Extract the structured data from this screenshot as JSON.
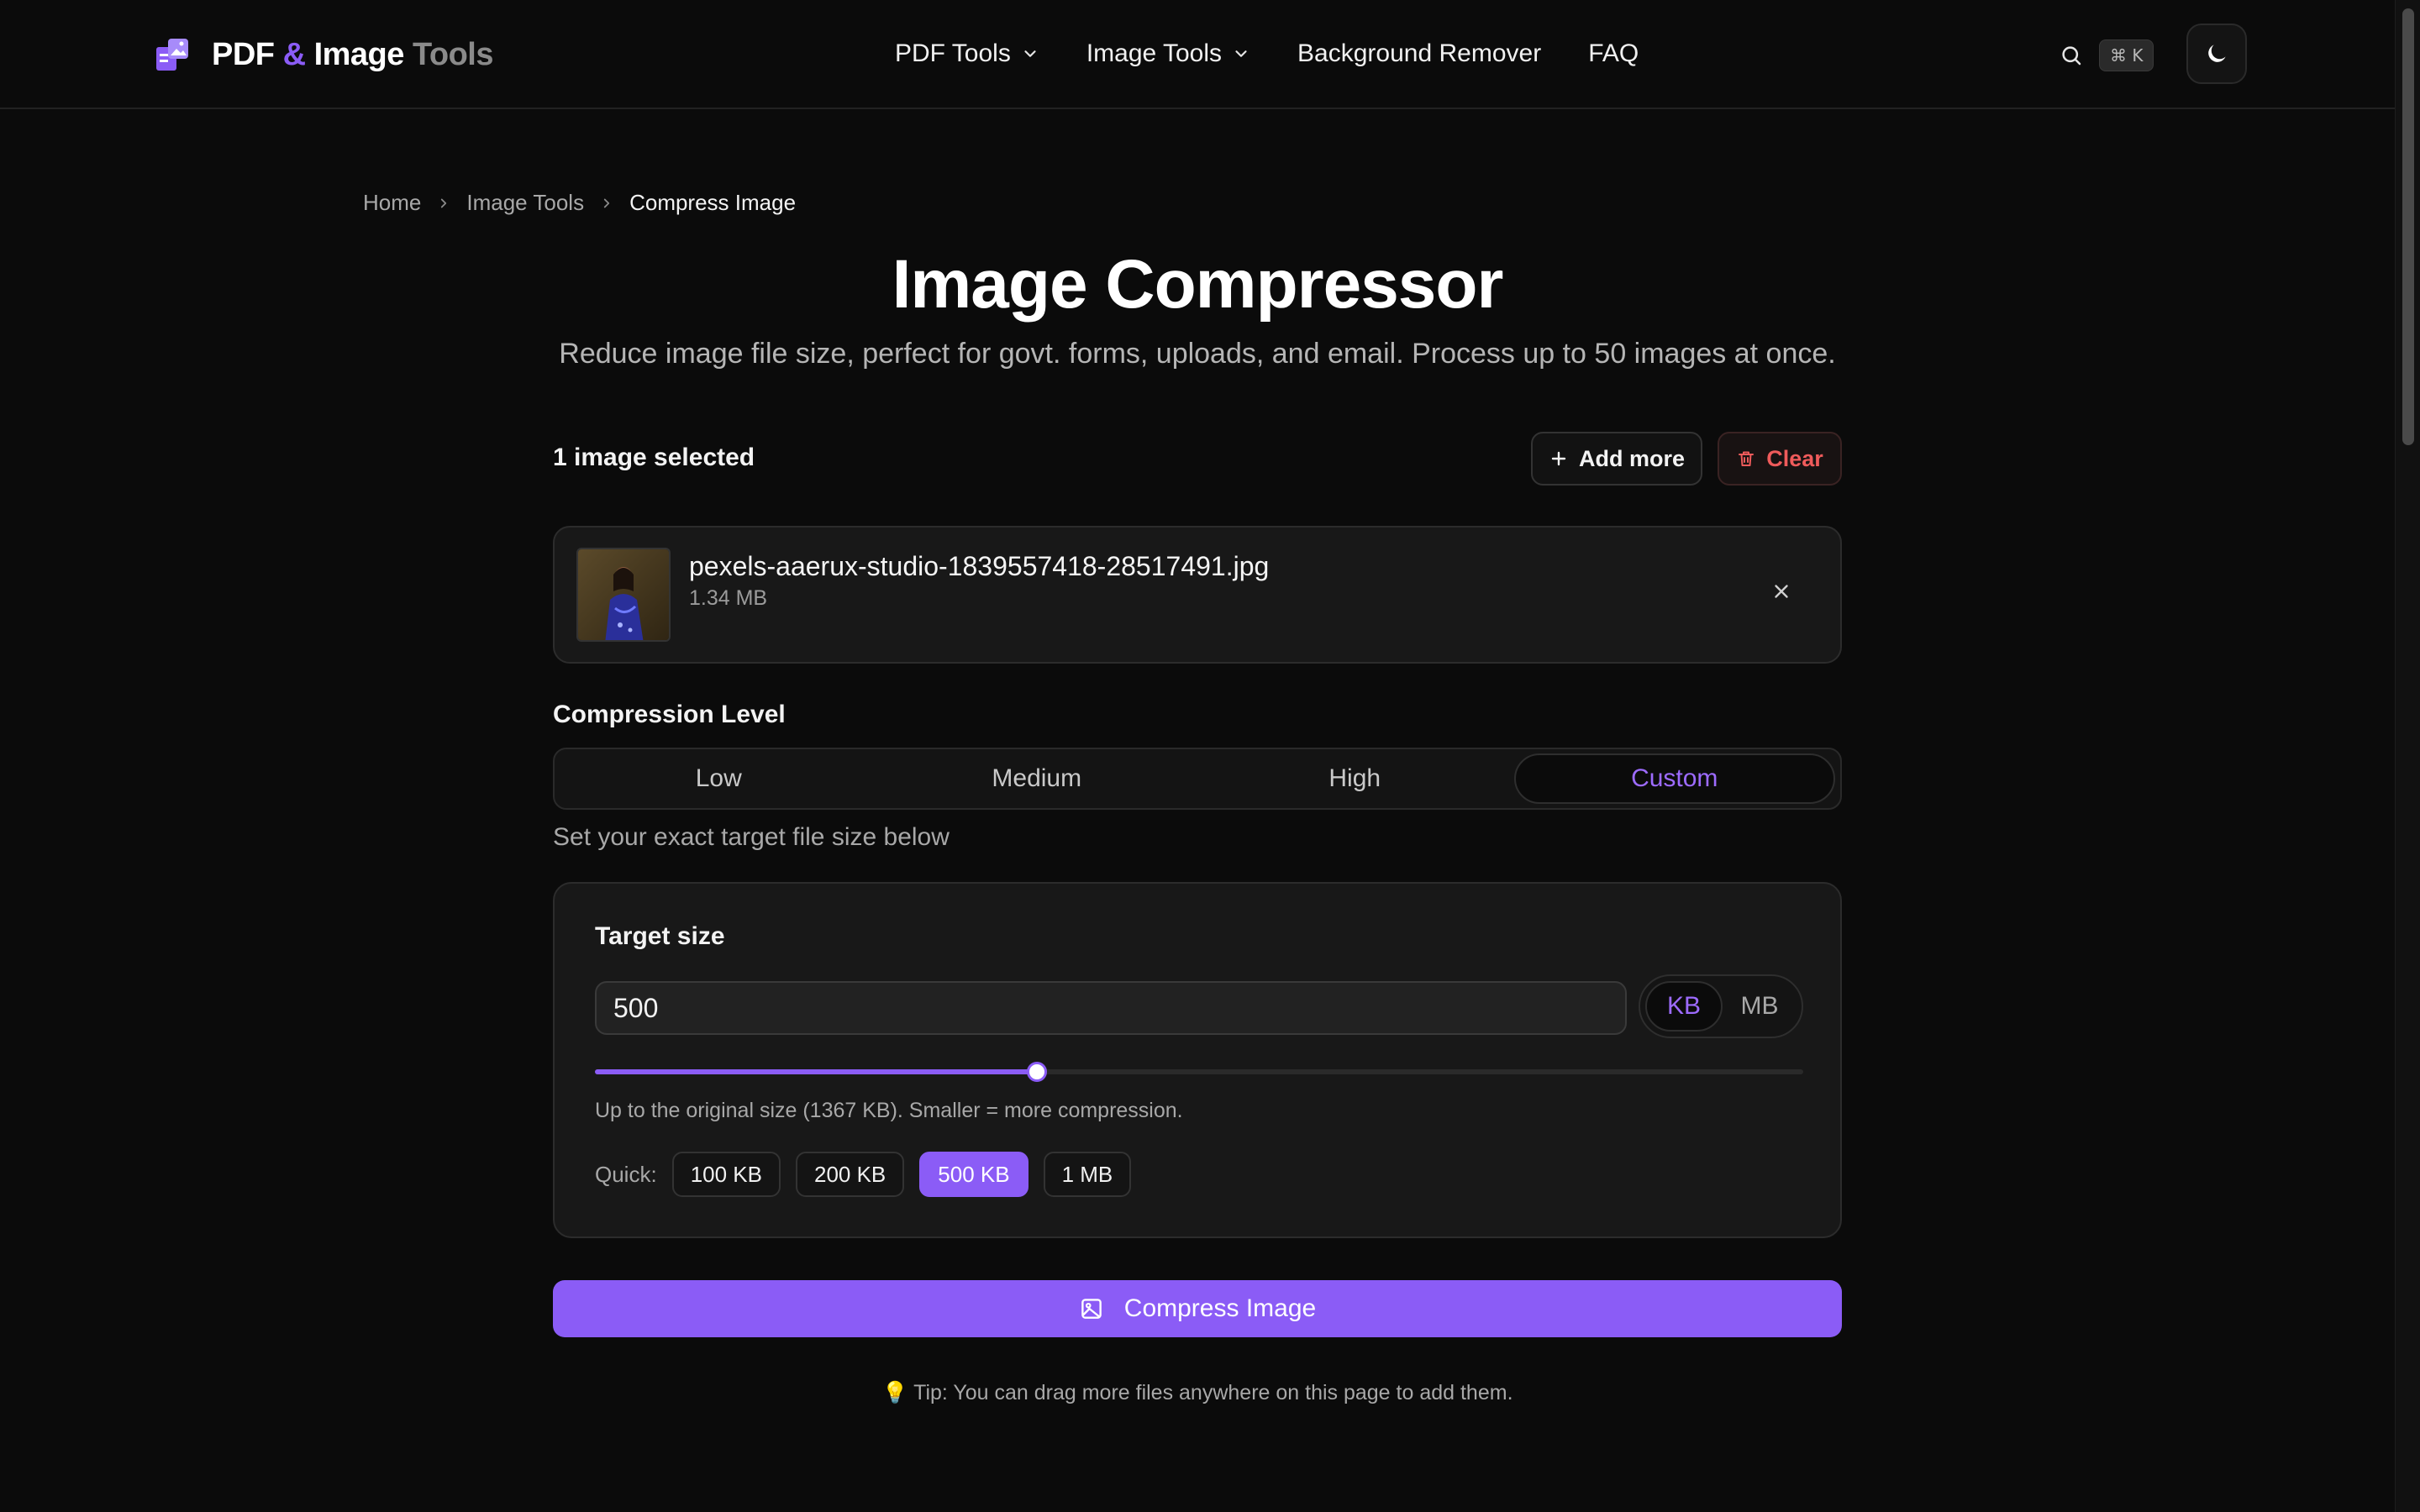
{
  "brand": {
    "part1": "PDF",
    "amp": "&",
    "part2": "Image",
    "part3": "Tools",
    "logo_icon": "pdf-image-logo"
  },
  "nav": {
    "pdf_tools": "PDF Tools",
    "image_tools": "Image Tools",
    "bg_remover": "Background Remover",
    "faq": "FAQ"
  },
  "search": {
    "shortcut": "⌘ K"
  },
  "breadcrumb": {
    "home": "Home",
    "section": "Image Tools",
    "current": "Compress Image"
  },
  "hero": {
    "title": "Image Compressor",
    "subtitle": "Reduce image file size, perfect for govt. forms, uploads, and email. Process up to 50 images at once."
  },
  "selection": {
    "count_label": "1 image selected",
    "add_more": "Add more",
    "clear": "Clear"
  },
  "file": {
    "name": "pexels-aaerux-studio-1839557418-28517491.jpg",
    "size": "1.34 MB"
  },
  "compression": {
    "label": "Compression Level",
    "options": [
      "Low",
      "Medium",
      "High",
      "Custom"
    ],
    "selected": "Custom",
    "hint": "Set your exact target file size below"
  },
  "target": {
    "label": "Target size",
    "value": "500",
    "units": [
      "KB",
      "MB"
    ],
    "selected_unit": "KB",
    "slider_fraction": 0.366,
    "help": "Up to the original size (1367 KB). Smaller = more compression.",
    "quick_label": "Quick:",
    "quick_options": [
      "100 KB",
      "200 KB",
      "500 KB",
      "1 MB"
    ],
    "quick_selected": "500 KB"
  },
  "action": {
    "compress": "Compress Image"
  },
  "tip": "💡 Tip: You can drag more files anywhere on this page to add them.",
  "colors": {
    "accent": "#8b5cf6",
    "danger": "#ef5b5b",
    "background": "#0b0b0b"
  }
}
